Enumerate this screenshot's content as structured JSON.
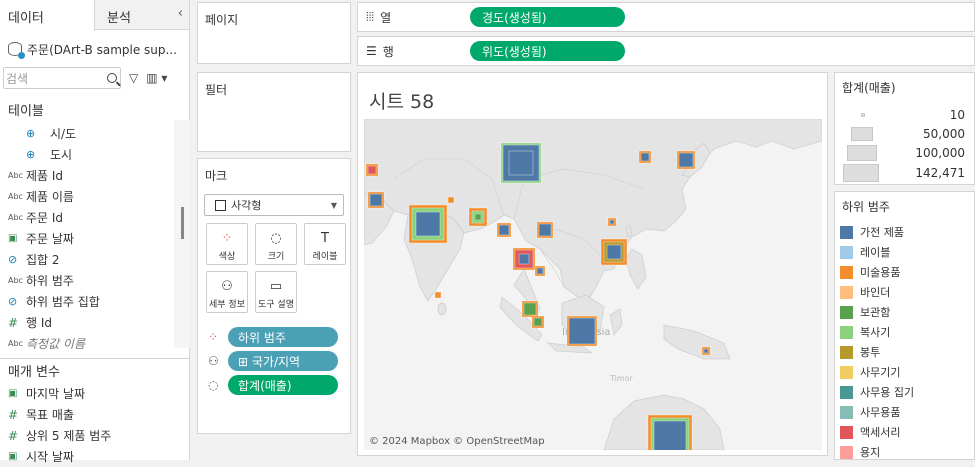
{
  "left_pane": {
    "tab_data": "데이터",
    "tab_analytics": "분석",
    "collapse": "‹",
    "datasource": "주문(DArt-B sample sup...",
    "search_placeholder": "검색",
    "tables_title": "테이블",
    "fields": [
      {
        "icon": "globe",
        "label": "시/도"
      },
      {
        "icon": "globe",
        "label": "도시"
      },
      {
        "icon": "abc",
        "label": "제품 Id"
      },
      {
        "icon": "abc",
        "label": "제품 이름"
      },
      {
        "icon": "abc",
        "label": "주문 Id"
      },
      {
        "icon": "calendar",
        "label": "주문 날짜"
      },
      {
        "icon": "set",
        "label": "집합 2"
      },
      {
        "icon": "abc",
        "label": "하위 범주"
      },
      {
        "icon": "set",
        "label": "하위 범주 집합"
      },
      {
        "icon": "hash",
        "label": "행 Id"
      },
      {
        "icon": "abc",
        "label": "측정값 이름"
      }
    ],
    "params_title": "매개 변수",
    "params": [
      {
        "icon": "calendar",
        "label": "마지막 날짜"
      },
      {
        "icon": "hash",
        "label": "목표 매출"
      },
      {
        "icon": "hash",
        "label": "상위 5 제품 범주"
      },
      {
        "icon": "calendar",
        "label": "시작 날짜"
      }
    ]
  },
  "pages_title": "페이지",
  "filters_title": "필터",
  "marks": {
    "title": "마크",
    "type": "사각형",
    "buttons": {
      "color": "색상",
      "size": "크기",
      "label": "레이블",
      "detail": "세부 정보",
      "tooltip": "도구 설명"
    },
    "pills": [
      {
        "label": "하위 범주",
        "color": "#4aa0b5"
      },
      {
        "label": "⊞ 국가/지역",
        "color": "#4aa0b5"
      },
      {
        "label": "합계(매출)",
        "color": "#00a86b"
      }
    ]
  },
  "columns_shelf": {
    "label": "열",
    "pill": "경도(생성됨)"
  },
  "rows_shelf": {
    "label": "행",
    "pill": "위도(생성됨)"
  },
  "sheet": {
    "title": "시트 58",
    "attribution": "© 2024 Mapbox © OpenStreetMap"
  },
  "size_legend": {
    "title": "합계(매출)",
    "values": [
      "10",
      "50,000",
      "100,000",
      "142,471"
    ]
  },
  "color_legend": {
    "title": "하위 범주",
    "items": [
      {
        "label": "가전 제품",
        "color": "#4e79a7"
      },
      {
        "label": "레이블",
        "color": "#a0cbe8"
      },
      {
        "label": "미술용품",
        "color": "#f28e2b"
      },
      {
        "label": "바인더",
        "color": "#ffbe7d"
      },
      {
        "label": "보관함",
        "color": "#59a14f"
      },
      {
        "label": "복사기",
        "color": "#8cd17d"
      },
      {
        "label": "봉투",
        "color": "#b6992d"
      },
      {
        "label": "사무기기",
        "color": "#f1ce63"
      },
      {
        "label": "사무용 집기",
        "color": "#499894"
      },
      {
        "label": "사무용품",
        "color": "#86bcb6"
      },
      {
        "label": "액세서리",
        "color": "#e15759"
      },
      {
        "label": "용지",
        "color": "#ff9d9a"
      }
    ]
  }
}
